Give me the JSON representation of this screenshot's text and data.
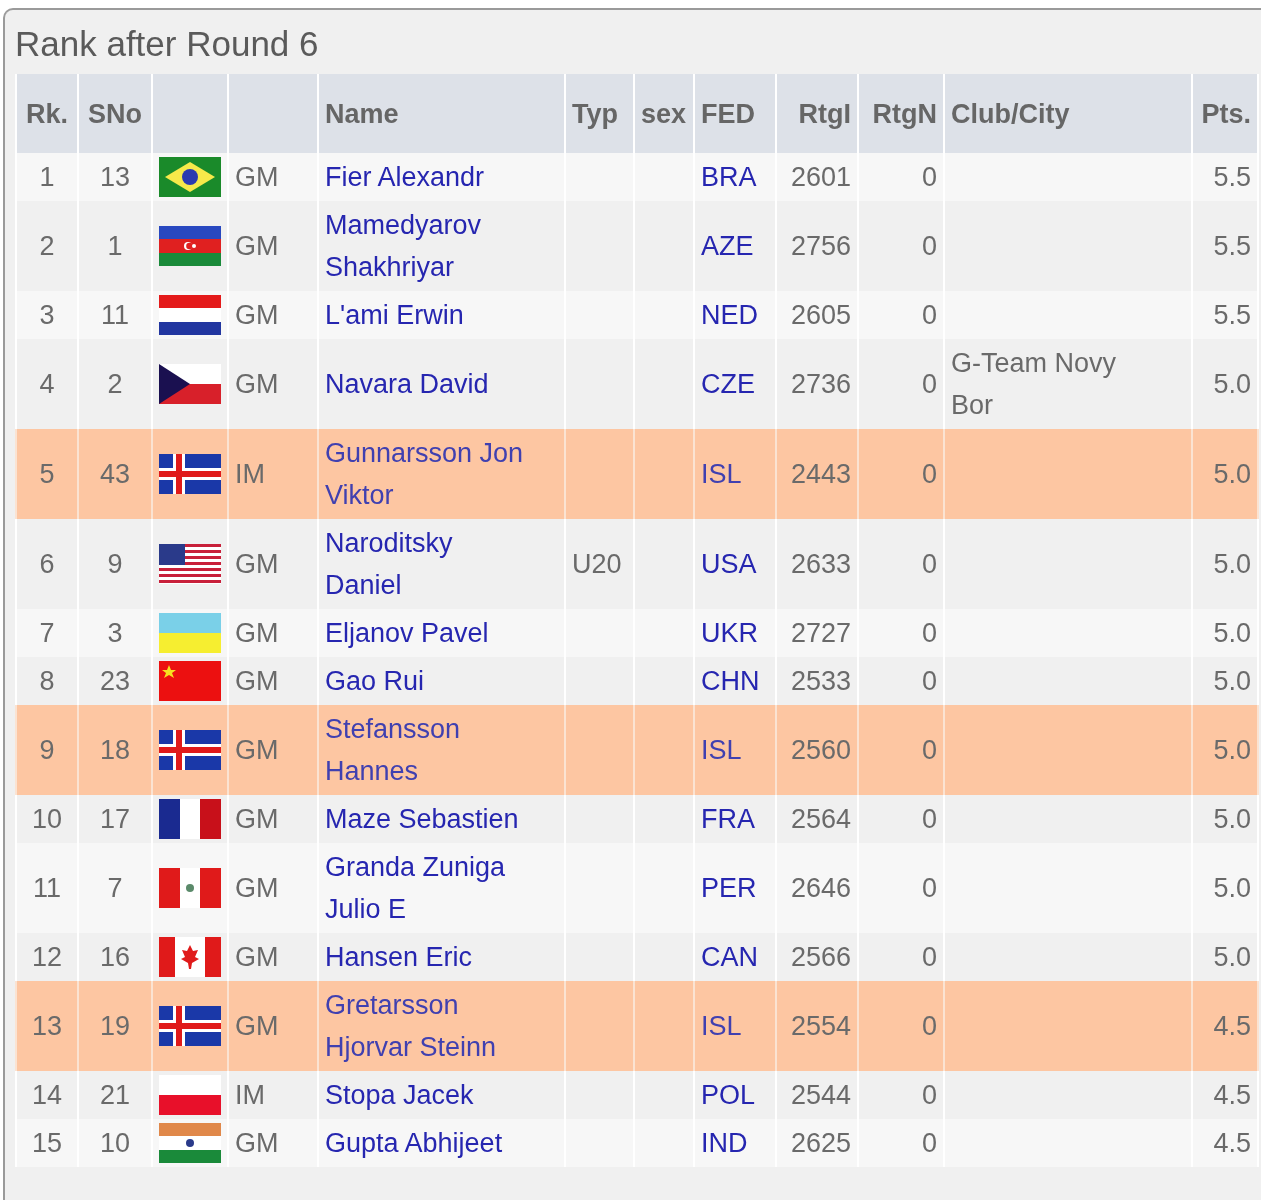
{
  "panel": {
    "title": "Rank after Round 6"
  },
  "table": {
    "columns": [
      "Rk.",
      "SNo",
      "",
      "",
      "Name",
      "Typ",
      "sex",
      "FED",
      "RtgI",
      "RtgN",
      "Club/City",
      "Pts."
    ],
    "rows": [
      {
        "rank": "1",
        "sno": "13",
        "title": "GM",
        "name": "Fier Alexandr",
        "fed": "BRA",
        "rtgi": "2601",
        "rtgn": "0",
        "pts": "5.5",
        "highlighted": false
      },
      {
        "rank": "2",
        "sno": "1",
        "title": "GM",
        "name": "Mamedyarov Shakhriyar",
        "fed": "AZE",
        "rtgi": "2756",
        "rtgn": "0",
        "pts": "5.5",
        "highlighted": false
      },
      {
        "rank": "3",
        "sno": "11",
        "title": "GM",
        "name": "L'ami Erwin",
        "fed": "NED",
        "rtgi": "2605",
        "rtgn": "0",
        "pts": "5.5",
        "highlighted": false
      },
      {
        "rank": "4",
        "sno": "2",
        "title": "GM",
        "name": "Navara David",
        "fed": "CZE",
        "rtgi": "2736",
        "rtgn": "0",
        "club": "G-Team Novy Bor",
        "pts": "5.0",
        "highlighted": false
      },
      {
        "rank": "5",
        "sno": "43",
        "title": "IM",
        "name": "Gunnarsson Jon Viktor",
        "fed": "ISL",
        "rtgi": "2443",
        "rtgn": "0",
        "pts": "5.0",
        "highlighted": true
      },
      {
        "rank": "6",
        "sno": "9",
        "title": "GM",
        "name": "Naroditsky Daniel",
        "typ": "U20",
        "fed": "USA",
        "rtgi": "2633",
        "rtgn": "0",
        "pts": "5.0",
        "highlighted": false
      },
      {
        "rank": "7",
        "sno": "3",
        "title": "GM",
        "name": "Eljanov Pavel",
        "fed": "UKR",
        "rtgi": "2727",
        "rtgn": "0",
        "pts": "5.0",
        "highlighted": false
      },
      {
        "rank": "8",
        "sno": "23",
        "title": "GM",
        "name": "Gao Rui",
        "fed": "CHN",
        "rtgi": "2533",
        "rtgn": "0",
        "pts": "5.0",
        "highlighted": false
      },
      {
        "rank": "9",
        "sno": "18",
        "title": "GM",
        "name": "Stefansson Hannes",
        "fed": "ISL",
        "rtgi": "2560",
        "rtgn": "0",
        "pts": "5.0",
        "highlighted": true
      },
      {
        "rank": "10",
        "sno": "17",
        "title": "GM",
        "name": "Maze Sebastien",
        "fed": "FRA",
        "rtgi": "2564",
        "rtgn": "0",
        "pts": "5.0",
        "highlighted": false
      },
      {
        "rank": "11",
        "sno": "7",
        "title": "GM",
        "name": "Granda Zuniga Julio E",
        "fed": "PER",
        "rtgi": "2646",
        "rtgn": "0",
        "pts": "5.0",
        "highlighted": false
      },
      {
        "rank": "12",
        "sno": "16",
        "title": "GM",
        "name": "Hansen Eric",
        "fed": "CAN",
        "rtgi": "2566",
        "rtgn": "0",
        "pts": "5.0",
        "highlighted": false
      },
      {
        "rank": "13",
        "sno": "19",
        "title": "GM",
        "name": "Gretarsson Hjorvar Steinn",
        "fed": "ISL",
        "rtgi": "2554",
        "rtgn": "0",
        "pts": "4.5",
        "highlighted": true
      },
      {
        "rank": "14",
        "sno": "21",
        "title": "IM",
        "name": "Stopa Jacek",
        "fed": "POL",
        "rtgi": "2544",
        "rtgn": "0",
        "pts": "4.5",
        "highlighted": false
      },
      {
        "rank": "15",
        "sno": "10",
        "title": "GM",
        "name": "Gupta Abhijeet",
        "fed": "IND",
        "rtgi": "2625",
        "rtgn": "0",
        "pts": "4.5",
        "highlighted": false
      }
    ]
  }
}
